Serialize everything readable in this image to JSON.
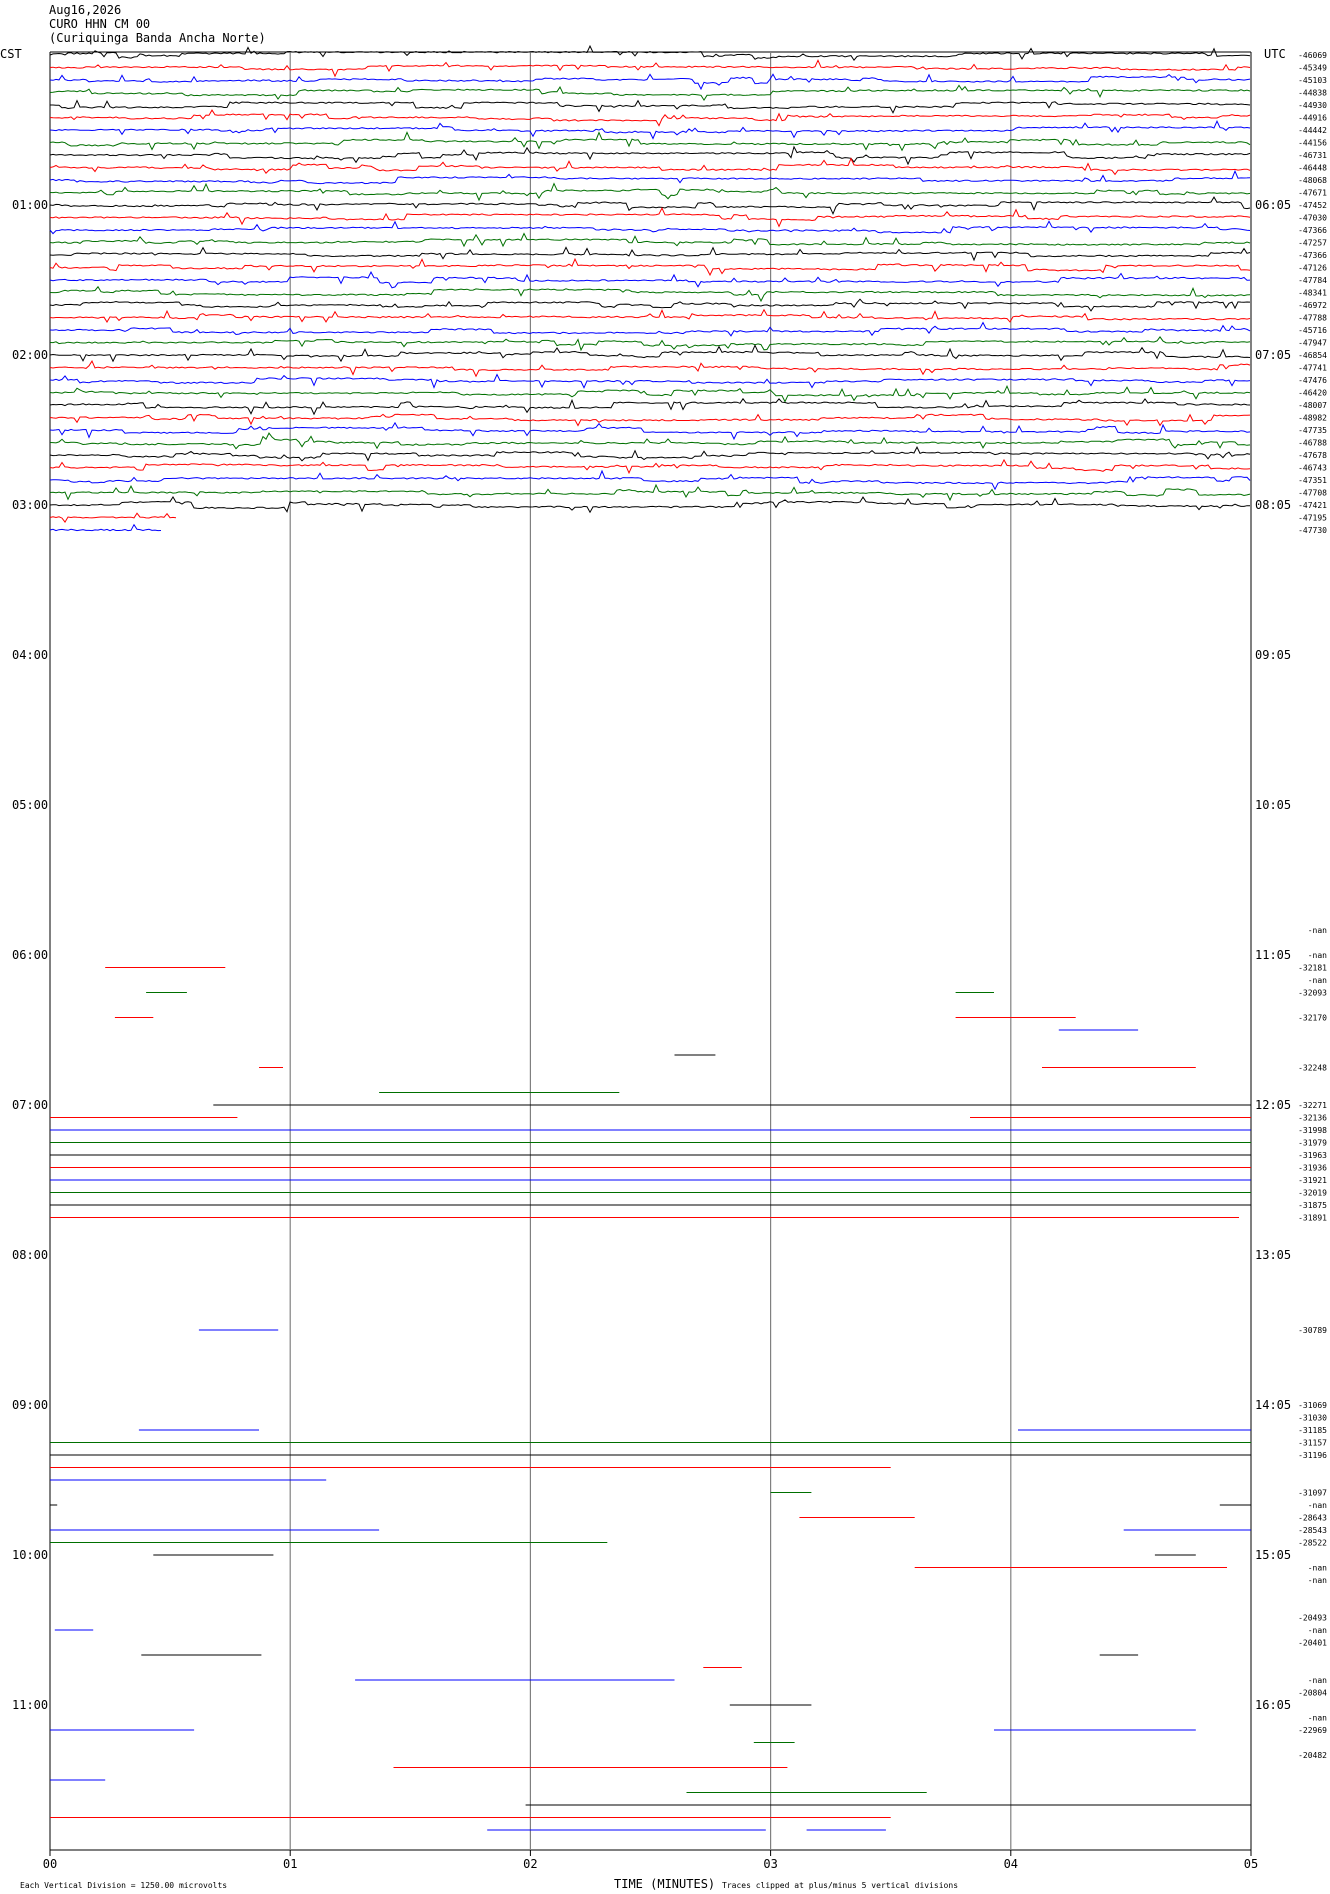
{
  "header": {
    "date": "Aug16,2026",
    "station": "CURO HHN CM 00",
    "site": "(Curiquinga Banda Ancha Norte)"
  },
  "tz": {
    "left": "CST",
    "right": "UTC"
  },
  "footer": {
    "scale_note": "Each Vertical Division = 1250.00 microvolts",
    "axis_title": "TIME (MINUTES)",
    "clip_note": "Traces clipped at plus/minus 5 vertical divisions"
  },
  "colors": {
    "black": "#000000",
    "red": "#ff0000",
    "blue": "#0000ff",
    "green": "#007000",
    "grid": "#808080"
  },
  "chart_data": {
    "type": "line",
    "title": "",
    "xlabel": "TIME (MINUTES)",
    "xlim": [
      0,
      5
    ],
    "x_ticks": [
      "00",
      "01",
      "02",
      "03",
      "04",
      "05"
    ],
    "row_count": 72,
    "row_minutes": 5,
    "hour_labels_left": [
      "01:00",
      "02:00",
      "03:00",
      "04:00",
      "05:00",
      "06:00",
      "07:00",
      "08:00",
      "09:00",
      "10:00",
      "11:00"
    ],
    "hour_labels_right": [
      "06:05",
      "07:05",
      "08:05",
      "09:05",
      "10:05",
      "11:05",
      "12:05",
      "13:05",
      "14:05",
      "15:05",
      "16:05"
    ],
    "hour_label_rows": [
      12,
      24,
      36,
      48,
      60,
      72,
      84,
      96,
      108,
      120,
      132
    ],
    "series_color_cycle": [
      "black",
      "red",
      "blue",
      "green"
    ],
    "right_labels": [
      {
        "row": 0,
        "text": "-46069"
      },
      {
        "row": 1,
        "text": "-45349"
      },
      {
        "row": 2,
        "text": "-45103"
      },
      {
        "row": 3,
        "text": "-44838"
      },
      {
        "row": 4,
        "text": "-44930"
      },
      {
        "row": 5,
        "text": "-44916"
      },
      {
        "row": 6,
        "text": "-44442"
      },
      {
        "row": 7,
        "text": "-44156"
      },
      {
        "row": 8,
        "text": "-46731"
      },
      {
        "row": 9,
        "text": "-46448"
      },
      {
        "row": 10,
        "text": "-48068"
      },
      {
        "row": 11,
        "text": "-47671"
      },
      {
        "row": 12,
        "text": "-47452"
      },
      {
        "row": 13,
        "text": "-47030"
      },
      {
        "row": 14,
        "text": "-47366"
      },
      {
        "row": 15,
        "text": "-47257"
      },
      {
        "row": 16,
        "text": "-47366"
      },
      {
        "row": 17,
        "text": "-47126"
      },
      {
        "row": 18,
        "text": "-47784"
      },
      {
        "row": 19,
        "text": "-48341"
      },
      {
        "row": 20,
        "text": "-46972"
      },
      {
        "row": 21,
        "text": "-47788"
      },
      {
        "row": 22,
        "text": "-45716"
      },
      {
        "row": 23,
        "text": "-47947"
      },
      {
        "row": 24,
        "text": "-46854"
      },
      {
        "row": 25,
        "text": "-47741"
      },
      {
        "row": 26,
        "text": "-47476"
      },
      {
        "row": 27,
        "text": "-46420"
      },
      {
        "row": 28,
        "text": "-48007"
      },
      {
        "row": 29,
        "text": "-48982"
      },
      {
        "row": 30,
        "text": "-47735"
      },
      {
        "row": 31,
        "text": "-46788"
      },
      {
        "row": 32,
        "text": "-47678"
      },
      {
        "row": 33,
        "text": "-46743"
      },
      {
        "row": 34,
        "text": "-47351"
      },
      {
        "row": 35,
        "text": "-47708"
      },
      {
        "row": 36,
        "text": "-47421"
      },
      {
        "row": 37,
        "text": "-47195"
      },
      {
        "row": 38,
        "text": "-47730"
      },
      {
        "row": 70,
        "text": "-nan"
      },
      {
        "row": 72,
        "text": "-nan"
      },
      {
        "row": 73,
        "text": "-32181"
      },
      {
        "row": 74,
        "text": "-nan"
      },
      {
        "row": 75,
        "text": "-32093"
      },
      {
        "row": 77,
        "text": "-32170"
      },
      {
        "row": 81,
        "text": "-32248"
      },
      {
        "row": 84,
        "text": "-32271"
      },
      {
        "row": 85,
        "text": "-32136"
      },
      {
        "row": 86,
        "text": "-31998"
      },
      {
        "row": 87,
        "text": "-31979"
      },
      {
        "row": 88,
        "text": "-31963"
      },
      {
        "row": 89,
        "text": "-31936"
      },
      {
        "row": 90,
        "text": "-31921"
      },
      {
        "row": 91,
        "text": "-32019"
      },
      {
        "row": 92,
        "text": "-31875"
      },
      {
        "row": 93,
        "text": "-31891"
      },
      {
        "row": 102,
        "text": "-30789"
      },
      {
        "row": 108,
        "text": "-31069"
      },
      {
        "row": 109,
        "text": "-31030"
      },
      {
        "row": 110,
        "text": "-31185"
      },
      {
        "row": 111,
        "text": "-31157"
      },
      {
        "row": 112,
        "text": "-31196"
      },
      {
        "row": 115,
        "text": "-31097"
      },
      {
        "row": 116,
        "text": "-nan"
      },
      {
        "row": 117,
        "text": "-28643"
      },
      {
        "row": 118,
        "text": "-28543"
      },
      {
        "row": 119,
        "text": "-28522"
      },
      {
        "row": 121,
        "text": "-nan"
      },
      {
        "row": 122,
        "text": "-nan"
      },
      {
        "row": 125,
        "text": "-20493"
      },
      {
        "row": 126,
        "text": "-nan"
      },
      {
        "row": 127,
        "text": "-20401"
      },
      {
        "row": 130,
        "text": "-nan"
      },
      {
        "row": 131,
        "text": "-20804"
      },
      {
        "row": 133,
        "text": "-nan"
      },
      {
        "row": 134,
        "text": "-22969"
      },
      {
        "row": 136,
        "text": "-20482"
      }
    ],
    "full_rows_end": 38,
    "partial_rows": [
      {
        "row": 36,
        "spans": [
          [
            0,
            5
          ]
        ]
      },
      {
        "row": 37,
        "spans": [
          [
            0,
            0.53
          ]
        ]
      },
      {
        "row": 38,
        "spans": [
          [
            0,
            0.47
          ]
        ]
      },
      {
        "row": 73,
        "spans": [
          [
            0.23,
            0.73
          ]
        ]
      },
      {
        "row": 75,
        "spans": [
          [
            0.4,
            0.57
          ],
          [
            3.77,
            3.93
          ]
        ]
      },
      {
        "row": 77,
        "spans": [
          [
            0.27,
            0.43
          ],
          [
            3.77,
            4.27
          ]
        ]
      },
      {
        "row": 78,
        "spans": [
          [
            4.2,
            4.53
          ]
        ]
      },
      {
        "row": 80,
        "spans": [
          [
            2.6,
            2.77
          ]
        ]
      },
      {
        "row": 81,
        "spans": [
          [
            0.87,
            0.97
          ],
          [
            4.13,
            4.77
          ]
        ]
      },
      {
        "row": 83,
        "spans": [
          [
            1.37,
            2.37
          ]
        ]
      },
      {
        "row": 84,
        "spans": [
          [
            0.68,
            5
          ]
        ]
      },
      {
        "row": 85,
        "spans": [
          [
            0,
            0.78
          ],
          [
            3.83,
            5
          ]
        ]
      },
      {
        "row": 86,
        "spans": [
          [
            0,
            5
          ]
        ]
      },
      {
        "row": 87,
        "spans": [
          [
            0,
            5
          ]
        ]
      },
      {
        "row": 88,
        "spans": [
          [
            0,
            5
          ]
        ]
      },
      {
        "row": 89,
        "spans": [
          [
            0,
            5
          ]
        ]
      },
      {
        "row": 90,
        "spans": [
          [
            0,
            5
          ]
        ]
      },
      {
        "row": 91,
        "spans": [
          [
            0,
            5
          ]
        ]
      },
      {
        "row": 92,
        "spans": [
          [
            0,
            5
          ]
        ]
      },
      {
        "row": 93,
        "spans": [
          [
            0,
            4.95
          ]
        ]
      },
      {
        "row": 102,
        "spans": [
          [
            0.62,
            0.95
          ]
        ]
      },
      {
        "row": 110,
        "spans": [
          [
            0.37,
            0.87
          ],
          [
            4.03,
            5
          ]
        ]
      },
      {
        "row": 111,
        "spans": [
          [
            0,
            5
          ]
        ]
      },
      {
        "row": 112,
        "spans": [
          [
            0,
            5
          ]
        ]
      },
      {
        "row": 113,
        "spans": [
          [
            0,
            3.5
          ]
        ]
      },
      {
        "row": 114,
        "spans": [
          [
            0,
            1.15
          ]
        ]
      },
      {
        "row": 115,
        "spans": [
          [
            3.0,
            3.17
          ]
        ]
      },
      {
        "row": 116,
        "spans": [
          [
            0,
            0.03
          ],
          [
            4.87,
            5
          ]
        ]
      },
      {
        "row": 117,
        "spans": [
          [
            3.12,
            3.6
          ]
        ]
      },
      {
        "row": 118,
        "spans": [
          [
            0,
            1.37
          ],
          [
            4.47,
            5
          ]
        ]
      },
      {
        "row": 119,
        "spans": [
          [
            0,
            2.32
          ]
        ]
      },
      {
        "row": 120,
        "spans": [
          [
            0.43,
            0.93
          ],
          [
            4.6,
            4.77
          ]
        ]
      },
      {
        "row": 121,
        "spans": [
          [
            3.6,
            4.9
          ]
        ]
      },
      {
        "row": 126,
        "spans": [
          [
            0.02,
            0.18
          ]
        ]
      },
      {
        "row": 128,
        "spans": [
          [
            0.38,
            0.88
          ],
          [
            4.37,
            4.53
          ]
        ]
      },
      {
        "row": 129,
        "spans": [
          [
            2.72,
            2.88
          ]
        ]
      },
      {
        "row": 130,
        "spans": [
          [
            1.27,
            2.6
          ]
        ]
      },
      {
        "row": 132,
        "spans": [
          [
            2.83,
            3.17
          ]
        ]
      },
      {
        "row": 134,
        "spans": [
          [
            0,
            0.6
          ],
          [
            3.93,
            4.77
          ]
        ]
      },
      {
        "row": 135,
        "spans": [
          [
            2.93,
            3.1
          ]
        ]
      },
      {
        "row": 137,
        "spans": [
          [
            1.43,
            3.07
          ]
        ]
      },
      {
        "row": 138,
        "spans": [
          [
            0,
            0.23
          ]
        ]
      },
      {
        "row": 139,
        "spans": [
          [
            2.65,
            3.65
          ]
        ]
      },
      {
        "row": 140,
        "spans": [
          [
            1.98,
            5
          ]
        ]
      },
      {
        "row": 141,
        "spans": [
          [
            0,
            3.5
          ]
        ]
      },
      {
        "row": 142,
        "spans": [
          [
            1.82,
            2.98
          ],
          [
            3.15,
            3.48
          ]
        ]
      }
    ]
  }
}
